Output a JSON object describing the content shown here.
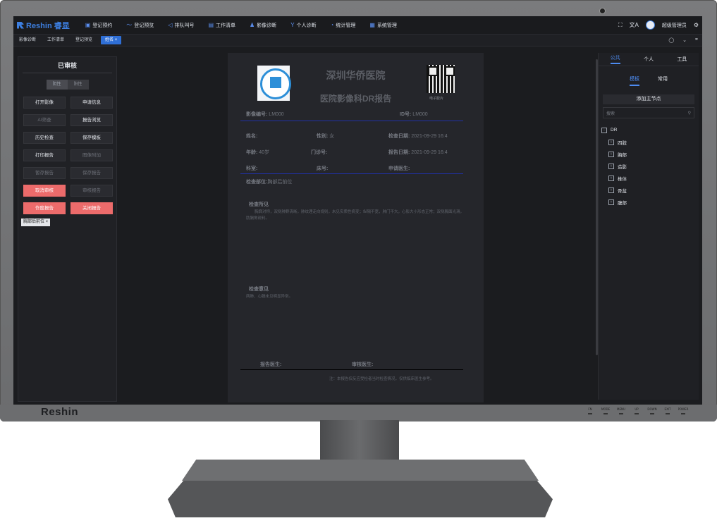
{
  "monitor": {
    "brand": "Reshin",
    "buttons": [
      "FN",
      "MODE",
      "MENU",
      "UP",
      "DOWN",
      "EXIT",
      "POWER"
    ]
  },
  "app": {
    "logo_text": "Reshin 睿显"
  },
  "nav": [
    {
      "label": "登记预约",
      "icon": "calendar-icon"
    },
    {
      "label": "登记预览",
      "icon": "wave-icon"
    },
    {
      "label": "排队叫号",
      "icon": "speaker-icon"
    },
    {
      "label": "工作清单",
      "icon": "list-icon"
    },
    {
      "label": "影像诊断",
      "icon": "person-icon"
    },
    {
      "label": "个人诊断",
      "icon": "branch-icon"
    },
    {
      "label": "统计管理",
      "icon": "chart-icon"
    },
    {
      "label": "系统管理",
      "icon": "settings-icon"
    }
  ],
  "header": {
    "user": "超级管理员",
    "fullscreen_icon": "⛶",
    "lang_icon": "文A",
    "gear_icon": "⚙"
  },
  "tabs": [
    "影像诊断",
    "工作清单",
    "登记预览",
    "姓名 ×"
  ],
  "tab_tools": [
    "◯",
    "⌄",
    "⌗"
  ],
  "left": {
    "title": "已审核",
    "toggle": [
      "阴性",
      "阳性"
    ],
    "buttons": [
      {
        "label": "打开影像",
        "state": "normal"
      },
      {
        "label": "申请信息",
        "state": "normal"
      },
      {
        "label": "AI筛查",
        "state": "disabled"
      },
      {
        "label": "报告浏览",
        "state": "normal"
      },
      {
        "label": "历史检查",
        "state": "normal"
      },
      {
        "label": "保存模板",
        "state": "normal"
      },
      {
        "label": "打印报告",
        "state": "normal"
      },
      {
        "label": "图像附加",
        "state": "disabled"
      },
      {
        "label": "暂存报告",
        "state": "disabled"
      },
      {
        "label": "保存报告",
        "state": "disabled"
      },
      {
        "label": "取消审核",
        "state": "red"
      },
      {
        "label": "审核报告",
        "state": "disabled"
      },
      {
        "label": "作废报告",
        "state": "red"
      },
      {
        "label": "关闭报告",
        "state": "red"
      }
    ],
    "chip": "胸部后前位 ×"
  },
  "report": {
    "hospital": "深圳华侨医院",
    "title": "医院影像科DR报告",
    "qr_label": "电子胶片",
    "image_no_label": "影像编号:",
    "image_no": "LM000",
    "id_label": "ID号:",
    "id_value": "LM000",
    "name_label": "姓名:",
    "sex_label": "性别:",
    "sex": "女",
    "check_date_label": "检查日期:",
    "check_date": "2021-09-29 16:4",
    "age_label": "年龄:",
    "age": "40岁",
    "clinic_label": "门诊号:",
    "report_date_label": "报告日期:",
    "report_date": "2021-09-29 16:4",
    "dept_label": "科室:",
    "bed_label": "床号:",
    "req_doctor_label": "申请医生:",
    "part_label": "检查部位:",
    "part": "胸部后前位",
    "findings_title": "检查所见",
    "findings": "胸廓对称，双侧肺野清晰，肺纹理走向规则，未见实质性病变；纵隔不宽，肺门不大，心影大小形态正常；双侧膈面光滑，肋膈角锐利。",
    "opinion_title": "检查意见",
    "opinion": "两肺、心膈未见明显异常。",
    "report_doctor_label": "报告医生:",
    "review_doctor_label": "审核医生:",
    "note": "注：本报告仅反应受检者当时检查情况，仅供临床医生参考。"
  },
  "right": {
    "tabs": [
      "公共",
      "个人",
      "工具"
    ],
    "subtabs": [
      "模板",
      "常用"
    ],
    "add_node": "添加主节点",
    "search_placeholder": "搜索",
    "root": "DR",
    "children": [
      "四肢",
      "胸部",
      "造影",
      "椎体",
      "骨盆",
      "腹部"
    ]
  },
  "colors": {
    "accent": "#3d7fe0",
    "danger": "#ec6b6b",
    "screen_bg": "#1b1c1f"
  }
}
